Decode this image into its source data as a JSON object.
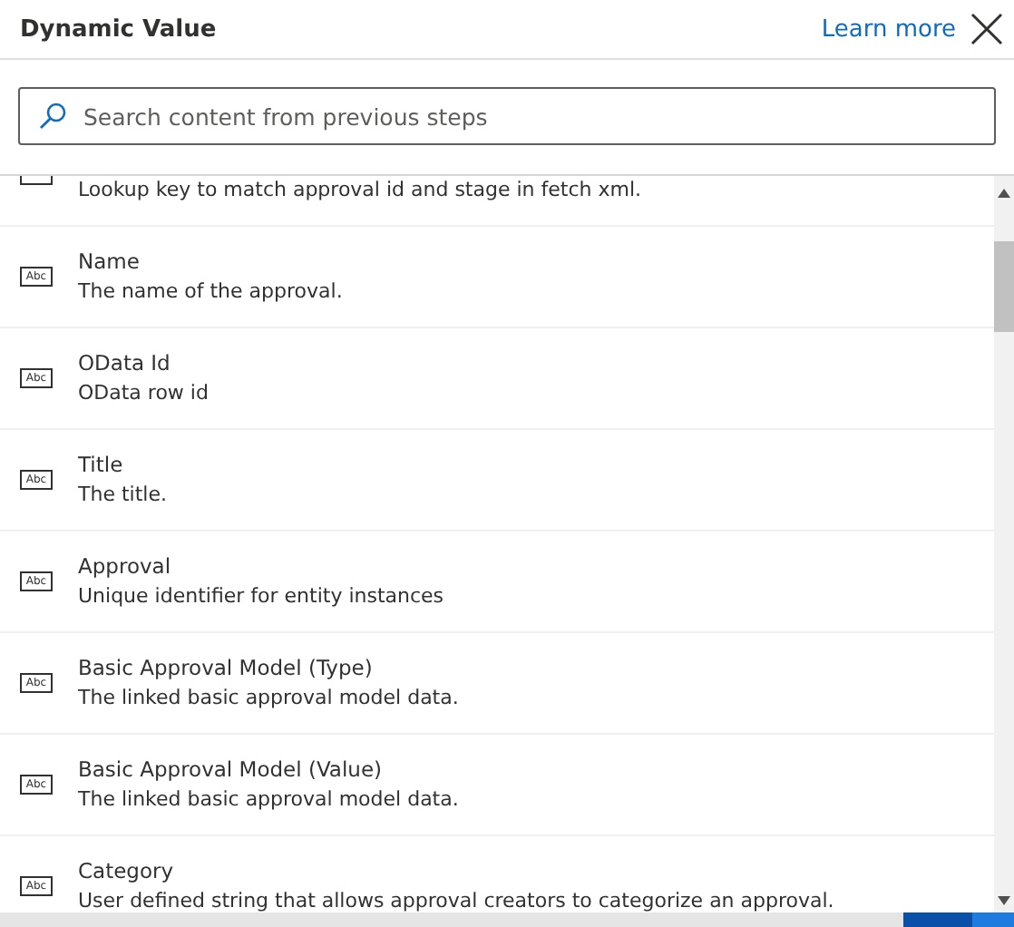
{
  "header": {
    "title": "Dynamic Value",
    "link": "Learn more"
  },
  "search": {
    "placeholder": "Search content from previous steps"
  },
  "items": [
    {
      "description": "Lookup key to match approval id and stage in fetch xml."
    },
    {
      "icon": "Abc",
      "title": "Name",
      "description": "The name of the approval."
    },
    {
      "icon": "Abc",
      "title": "OData Id",
      "description": "OData row id"
    },
    {
      "icon": "Abc",
      "title": "Title",
      "description": "The title."
    },
    {
      "icon": "Abc",
      "title": "Approval",
      "description": "Unique identifier for entity instances"
    },
    {
      "icon": "Abc",
      "title": "Basic Approval Model (Type)",
      "description": "The linked basic approval model data."
    },
    {
      "icon": "Abc",
      "title": "Basic Approval Model (Value)",
      "description": "The linked basic approval model data."
    },
    {
      "icon": "Abc",
      "title": "Category",
      "description": "User defined string that allows approval creators to categorize an approval."
    }
  ]
}
